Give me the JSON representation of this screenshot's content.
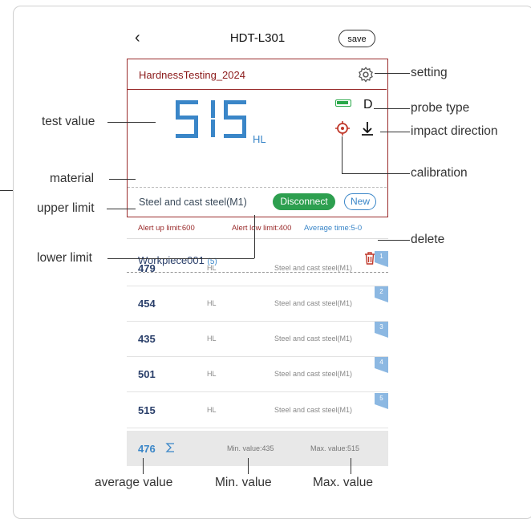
{
  "header": {
    "title": "HDT-L301",
    "save_label": "save"
  },
  "card": {
    "file_name": "HardnessTesting_2024",
    "test_value": "515",
    "unit": "HL",
    "probe_type": "D",
    "material": "Steel and cast steel(M1)",
    "disconnect_label": "Disconnect",
    "new_label": "New"
  },
  "limits": {
    "upper": "Alert up limit:600",
    "lower": "Alert low limit:400",
    "average": "Average time:5-0"
  },
  "workpiece": {
    "name": "Workpiece001",
    "count": "(5)"
  },
  "measurements": [
    {
      "value": "479",
      "unit": "HL",
      "material": "Steel and cast steel(M1)",
      "index": "1"
    },
    {
      "value": "454",
      "unit": "HL",
      "material": "Steel and cast steel(M1)",
      "index": "2"
    },
    {
      "value": "435",
      "unit": "HL",
      "material": "Steel and cast steel(M1)",
      "index": "3"
    },
    {
      "value": "501",
      "unit": "HL",
      "material": "Steel and cast steel(M1)",
      "index": "4"
    },
    {
      "value": "515",
      "unit": "HL",
      "material": "Steel and cast steel(M1)",
      "index": "5"
    }
  ],
  "stats": {
    "average": "476",
    "min": "Min. value:435",
    "max": "Max. value:515"
  },
  "annotations": {
    "setting": "setting",
    "probe_type": "probe type",
    "impact_direction": "impact direction",
    "calibration": "calibration",
    "delete": "delete",
    "test_value": "test value",
    "material": "material",
    "upper_limit": "upper limit",
    "lower_limit": "lower limit",
    "average_value": "average value",
    "min_value": "Min. value",
    "max_value": "Max. value"
  },
  "icons": [
    "back-icon",
    "gear-icon",
    "battery-icon",
    "target-icon",
    "impact-down-icon",
    "trash-icon",
    "sigma-icon"
  ],
  "colors": {
    "accent_red": "#9a2c2c",
    "accent_blue": "#3a86c8",
    "green": "#2d9f4f"
  }
}
